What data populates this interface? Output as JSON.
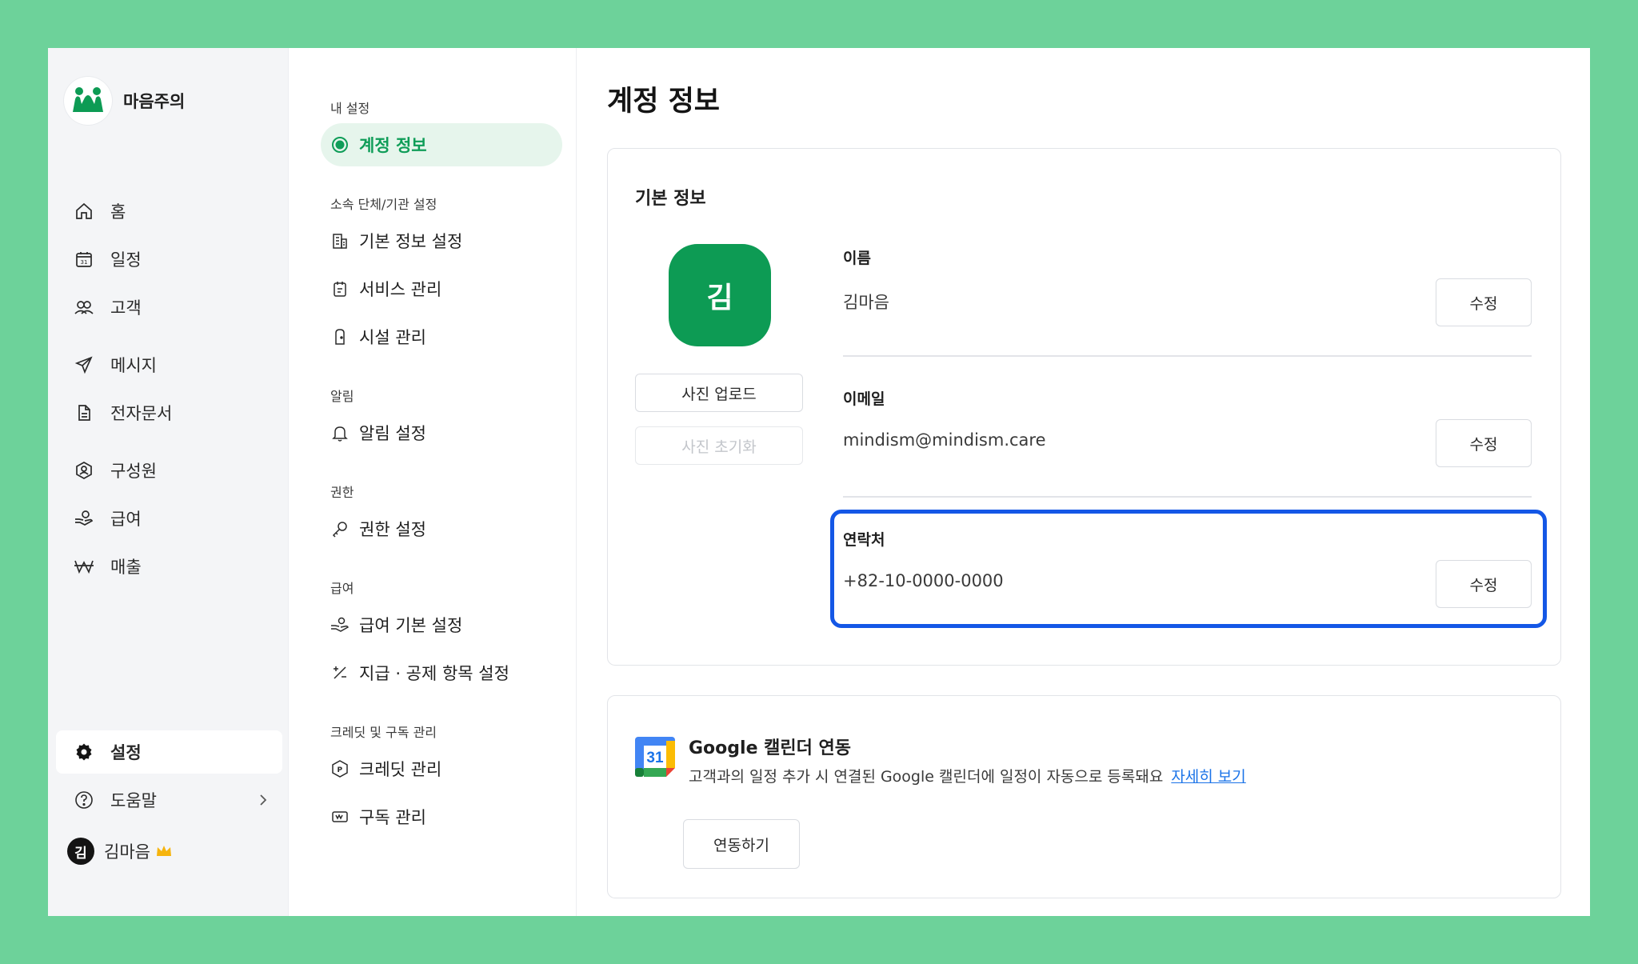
{
  "brand": {
    "name": "마음주의"
  },
  "nav": {
    "items": [
      {
        "label": "홈",
        "icon": "home-icon"
      },
      {
        "label": "일정",
        "icon": "calendar-icon"
      },
      {
        "label": "고객",
        "icon": "users-icon"
      },
      {
        "label": "메시지",
        "icon": "send-icon"
      },
      {
        "label": "전자문서",
        "icon": "document-icon"
      },
      {
        "label": "구성원",
        "icon": "member-icon"
      },
      {
        "label": "급여",
        "icon": "salary-icon"
      },
      {
        "label": "매출",
        "icon": "won-icon"
      }
    ],
    "settings": {
      "label": "설정",
      "icon": "gear-icon",
      "active": true
    },
    "help": {
      "label": "도움말",
      "icon": "help-icon"
    },
    "user": {
      "avatar": "김",
      "name": "김마음",
      "badge_icon": "crown-icon"
    }
  },
  "settings_menu": {
    "sections": {
      "my": "내 설정",
      "org": "소속 단체/기관 설정",
      "alert": "알림",
      "perm": "권한",
      "salary": "급여",
      "credit": "크레딧 및 구독 관리"
    },
    "items": {
      "account": "계정 정보",
      "basic_info": "기본 정보 설정",
      "service": "서비스 관리",
      "facility": "시설 관리",
      "alert_setting": "알림 설정",
      "perm_setting": "권한 설정",
      "salary_basic": "급여 기본 설정",
      "pay_deduct": "지급 · 공제 항목 설정",
      "credit_manage": "크레딧 관리",
      "subscription": "구독 관리"
    }
  },
  "page": {
    "title": "계정 정보"
  },
  "basic": {
    "title": "기본 정보",
    "avatar": "김",
    "upload_btn": "사진 업로드",
    "reset_btn": "사진 초기화",
    "fields": {
      "name": {
        "label": "이름",
        "value": "김마음",
        "edit": "수정"
      },
      "email": {
        "label": "이메일",
        "value": "mindism@mindism.care",
        "edit": "수정"
      },
      "phone": {
        "label": "연락처",
        "value": "+82-10-0000-0000",
        "edit": "수정"
      }
    }
  },
  "gcal": {
    "title": "Google 캘린더 연동",
    "desc": "고객과의 일정 추가 시 연결된 Google 캘린더에 일정이 자동으로 등록돼요",
    "link": "자세히 보기",
    "icon_day": "31",
    "connect_btn": "연동하기"
  },
  "colors": {
    "background": "#6dd29a",
    "brand_green": "#0d9b54",
    "active_menu_bg": "#e6f5ec",
    "highlight": "#1457e6",
    "link": "#1a73e8"
  }
}
